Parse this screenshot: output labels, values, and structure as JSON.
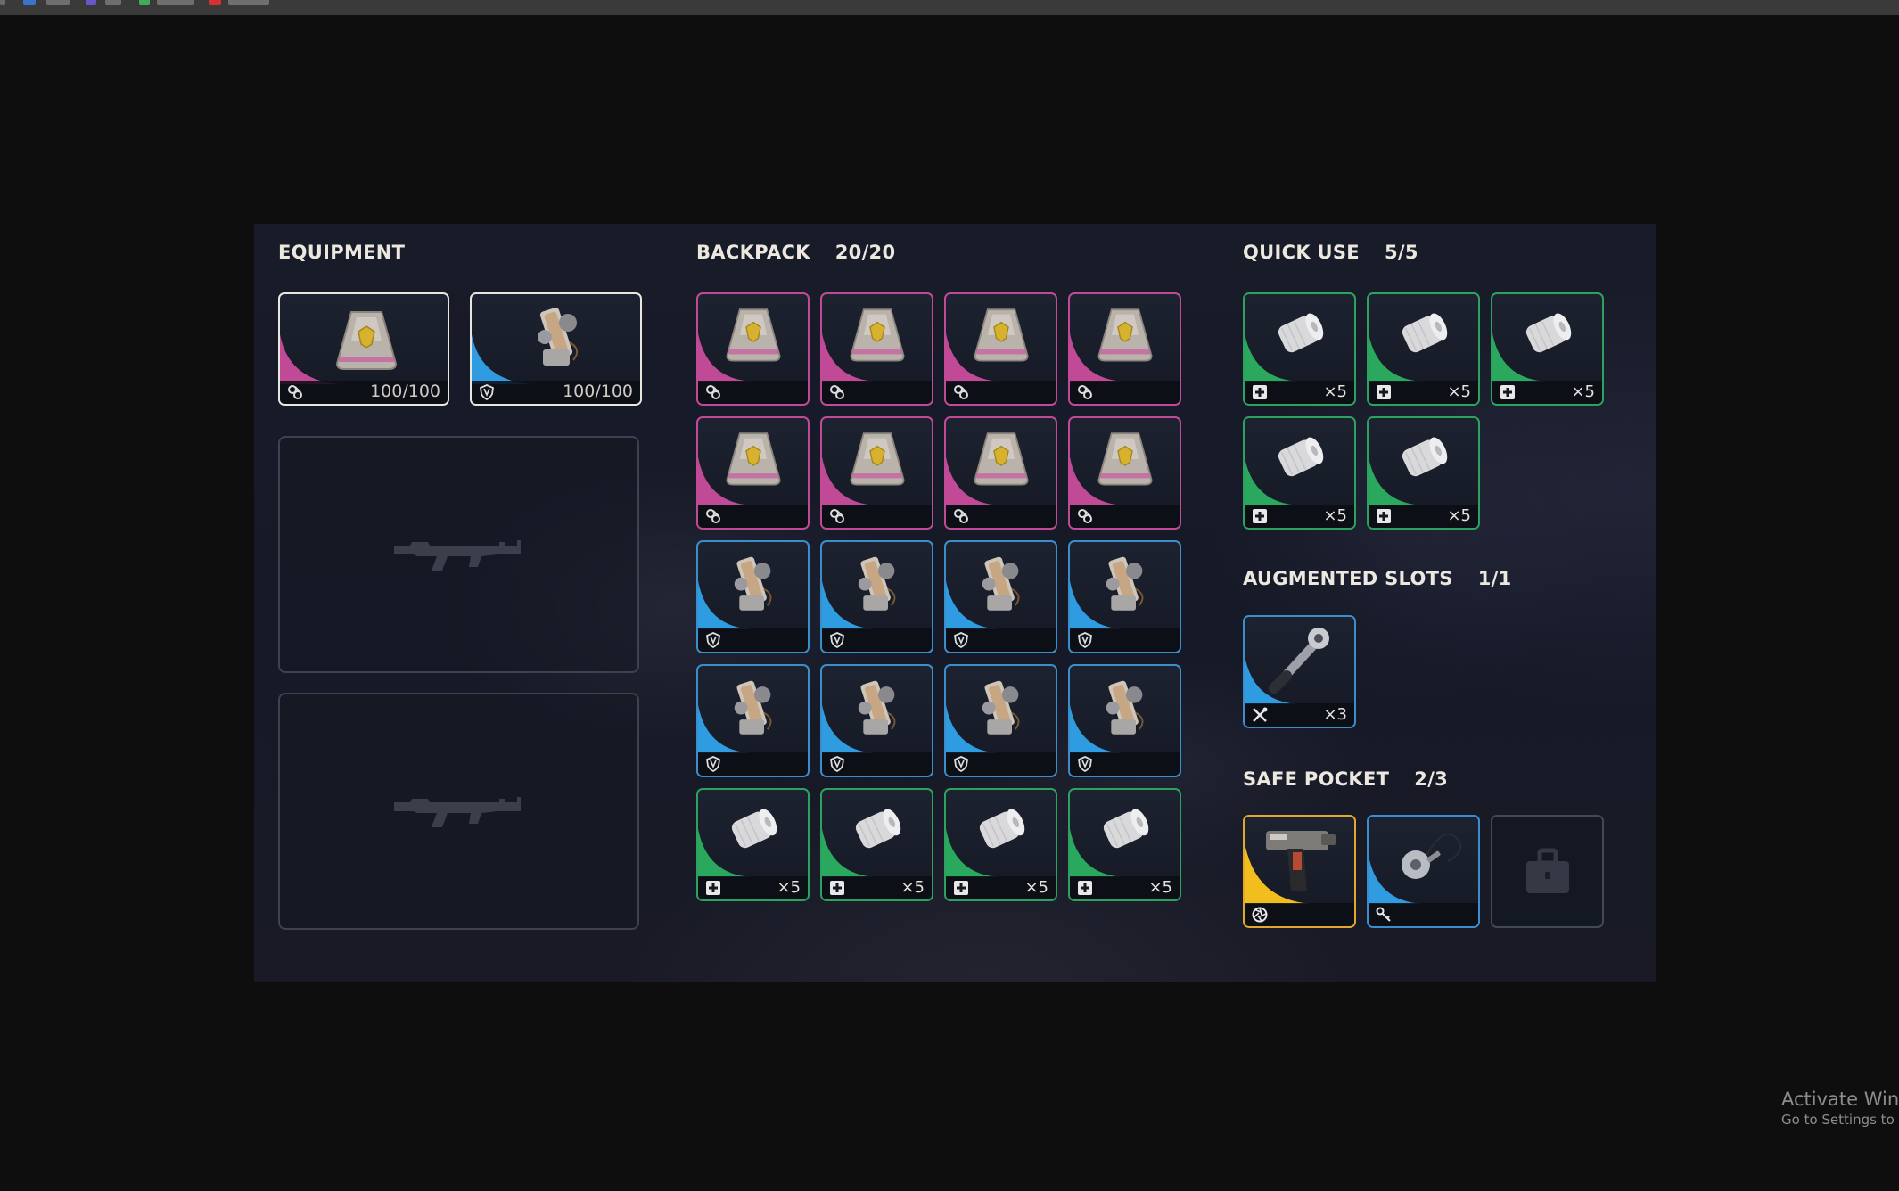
{
  "colors": {
    "pink": "#c14a96",
    "blue": "#3b8ecc",
    "green": "#2da160",
    "gold": "#e0a82c",
    "gray": "#434856"
  },
  "equipment": {
    "title": "EQUIPMENT",
    "augment": {
      "item": "augment-case",
      "rarity": "pink",
      "type_icon": "augment-icon",
      "durability": "100/100"
    },
    "shield": {
      "item": "shield-pack",
      "rarity": "blue",
      "type_icon": "shield-icon",
      "durability": "100/100"
    },
    "weapon_slots": [
      {
        "state": "empty",
        "silhouette": "rifle-silhouette-icon"
      },
      {
        "state": "empty",
        "silhouette": "rifle-silhouette-icon"
      }
    ]
  },
  "backpack": {
    "title": "BACKPACK",
    "count": "20/20",
    "slots": [
      {
        "item": "augment-case",
        "rarity": "pink",
        "type_icon": "augment-icon",
        "qty": ""
      },
      {
        "item": "augment-case",
        "rarity": "pink",
        "type_icon": "augment-icon",
        "qty": ""
      },
      {
        "item": "augment-case",
        "rarity": "pink",
        "type_icon": "augment-icon",
        "qty": ""
      },
      {
        "item": "augment-case",
        "rarity": "pink",
        "type_icon": "augment-icon",
        "qty": ""
      },
      {
        "item": "augment-case",
        "rarity": "pink",
        "type_icon": "augment-icon",
        "qty": ""
      },
      {
        "item": "augment-case",
        "rarity": "pink",
        "type_icon": "augment-icon",
        "qty": ""
      },
      {
        "item": "augment-case",
        "rarity": "pink",
        "type_icon": "augment-icon",
        "qty": ""
      },
      {
        "item": "augment-case",
        "rarity": "pink",
        "type_icon": "augment-icon",
        "qty": ""
      },
      {
        "item": "shield-pack",
        "rarity": "blue",
        "type_icon": "shield-icon",
        "qty": ""
      },
      {
        "item": "shield-pack",
        "rarity": "blue",
        "type_icon": "shield-icon",
        "qty": ""
      },
      {
        "item": "shield-pack",
        "rarity": "blue",
        "type_icon": "shield-icon",
        "qty": ""
      },
      {
        "item": "shield-pack",
        "rarity": "blue",
        "type_icon": "shield-icon",
        "qty": ""
      },
      {
        "item": "shield-pack",
        "rarity": "blue",
        "type_icon": "shield-icon",
        "qty": ""
      },
      {
        "item": "shield-pack",
        "rarity": "blue",
        "type_icon": "shield-icon",
        "qty": ""
      },
      {
        "item": "shield-pack",
        "rarity": "blue",
        "type_icon": "shield-icon",
        "qty": ""
      },
      {
        "item": "shield-pack",
        "rarity": "blue",
        "type_icon": "shield-icon",
        "qty": ""
      },
      {
        "item": "bandage-roll",
        "rarity": "green",
        "type_icon": "medical-plus-icon",
        "qty": "×5"
      },
      {
        "item": "bandage-roll",
        "rarity": "green",
        "type_icon": "medical-plus-icon",
        "qty": "×5"
      },
      {
        "item": "bandage-roll",
        "rarity": "green",
        "type_icon": "medical-plus-icon",
        "qty": "×5"
      },
      {
        "item": "bandage-roll",
        "rarity": "green",
        "type_icon": "medical-plus-icon",
        "qty": "×5"
      }
    ]
  },
  "quick_use": {
    "title": "QUICK USE",
    "count": "5/5",
    "slots": [
      {
        "item": "bandage-roll",
        "rarity": "green",
        "type_icon": "medical-plus-icon",
        "qty": "×5"
      },
      {
        "item": "bandage-roll",
        "rarity": "green",
        "type_icon": "medical-plus-icon",
        "qty": "×5"
      },
      {
        "item": "bandage-roll",
        "rarity": "green",
        "type_icon": "medical-plus-icon",
        "qty": "×5"
      },
      {
        "item": "bandage-roll",
        "rarity": "green",
        "type_icon": "medical-plus-icon",
        "qty": "×5"
      },
      {
        "item": "bandage-roll",
        "rarity": "green",
        "type_icon": "medical-plus-icon",
        "qty": "×5"
      }
    ]
  },
  "augmented_slots": {
    "title": "AUGMENTED SLOTS",
    "count": "1/1",
    "slots": [
      {
        "item": "repair-tool",
        "rarity": "blue",
        "type_icon": "tools-icon",
        "qty": "×3"
      }
    ]
  },
  "safe_pocket": {
    "title": "SAFE POCKET",
    "count": "2/3",
    "slots": [
      {
        "item": "tool-gun",
        "rarity": "gold",
        "type_icon": "aperture-icon",
        "qty": ""
      },
      {
        "item": "pendant-key",
        "rarity": "blue",
        "type_icon": "key-icon",
        "qty": ""
      },
      {
        "item": "locked",
        "rarity": "gray",
        "type_icon": "lock-icon",
        "qty": ""
      }
    ]
  },
  "watermark": {
    "line1": "Activate Windo",
    "line2": "Go to Settings to ac"
  }
}
